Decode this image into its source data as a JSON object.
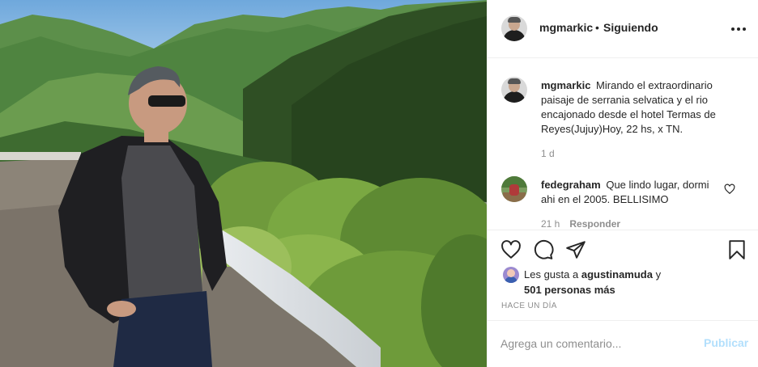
{
  "post": {
    "username": "mgmarkic",
    "separator": "•",
    "follow_status": "Siguiendo",
    "more_icon": "more-horizontal-icon"
  },
  "caption": {
    "username": "mgmarkic",
    "text": "Mirando el extraordinario paisaje de serrania selvatica y el rio encajonado desde el hotel Termas de Reyes(Jujuy)Hoy, 22 hs, x TN.",
    "time": "1 d"
  },
  "comments": [
    {
      "username": "fedegraham",
      "text": "Que lindo lugar, dormi ahi en el 2005. BELLISIMO",
      "time": "21 h",
      "reply_label": "Responder",
      "like_icon": "heart-outline-icon"
    }
  ],
  "actions": {
    "like_icon": "heart-outline-icon",
    "comment_icon": "comment-bubble-icon",
    "share_icon": "paper-plane-icon",
    "save_icon": "bookmark-icon"
  },
  "likes": {
    "prefix": "Les gusta a",
    "user": "agustinamuda",
    "conjunction": "y",
    "others": "501 personas más"
  },
  "timestamp": "HACE UN DÍA",
  "add_comment": {
    "placeholder": "Agrega un comentario...",
    "publish_label": "Publicar"
  },
  "colors": {
    "text": "#262626",
    "secondary": "#8e8e8e",
    "border": "#efefef",
    "publish_disabled": "#b2dffc"
  }
}
